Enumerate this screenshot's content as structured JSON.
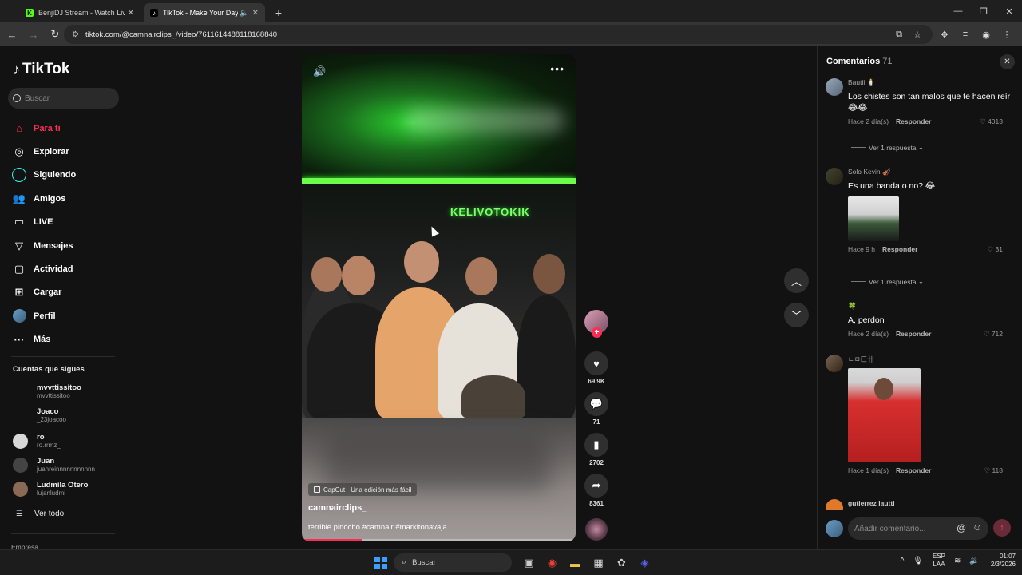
{
  "browser": {
    "tabs": [
      {
        "label": "BenjiDJ Stream - Watch Live o",
        "favicon": "kick-icon",
        "accent": "#53fc18"
      },
      {
        "label": "TikTok - Make Your Day",
        "favicon": "tiktok-icon",
        "accent": "#ffffff"
      }
    ],
    "new_tab": "+",
    "url": "tiktok.com/@camnairclips_/video/7611614488118168840"
  },
  "sidebar": {
    "logo": "TikTok",
    "search_placeholder": "Buscar",
    "nav": [
      {
        "label": "Para ti",
        "icon": "home-icon",
        "active": true
      },
      {
        "label": "Explorar",
        "icon": "compass-icon"
      },
      {
        "label": "Siguiendo",
        "icon": "following-ring-icon"
      },
      {
        "label": "Amigos",
        "icon": "friends-icon"
      },
      {
        "label": "LIVE",
        "icon": "live-icon"
      },
      {
        "label": "Mensajes",
        "icon": "messages-icon"
      },
      {
        "label": "Actividad",
        "icon": "activity-icon"
      },
      {
        "label": "Cargar",
        "icon": "upload-icon"
      },
      {
        "label": "Perfil",
        "icon": "profile-avatar-icon"
      },
      {
        "label": "Más",
        "icon": "more-icon"
      }
    ],
    "following_title": "Cuentas que sigues",
    "following": [
      {
        "name": "mvvttissitoo",
        "user": "mvvttissitoo"
      },
      {
        "name": "Joaco",
        "user": "_23joacoo"
      },
      {
        "name": "ro",
        "user": "ro.rrmz_"
      },
      {
        "name": "Juan",
        "user": "juanreinnnnnnnnnnn"
      },
      {
        "name": "Ludmila Otero",
        "user": "lujanludmi"
      }
    ],
    "see_all": "Ver todo",
    "footer": "Empresa"
  },
  "video": {
    "sign": "KELIVOTOKIK",
    "capcut": "CapCut · Una edición más fácil",
    "author": "camnairclips_",
    "caption": "terrible pinocho #camnair #markitonavaja",
    "progress": 0.22
  },
  "actions": {
    "likes": "69.9K",
    "comments": "71",
    "saves": "2702",
    "shares": "8361"
  },
  "comments": {
    "title": "Comentarios",
    "count": "71",
    "items": [
      {
        "user": "Bautii 🕯️",
        "text": "Los chistes son tan malos que te hacen reír 😂😂",
        "time": "Hace 2 día(s)",
        "reply": "Responder",
        "likes": "4013",
        "view_replies": "Ver 1 respuesta"
      },
      {
        "user": "Solo Kevin 🎻",
        "text": "Es una banda o no? 😂",
        "time": "Hace 9 h",
        "reply": "Responder",
        "likes": "31",
        "view_replies": "Ver 1 respuesta"
      },
      {
        "user": "🍀",
        "text": "A, perdon",
        "time": "Hace 2 día(s)",
        "reply": "Responder",
        "likes": "712"
      },
      {
        "user": "ㄴㅁ匚卄ㅣ",
        "text": "",
        "time": "Hace 1 día(s)",
        "reply": "Responder",
        "likes": "118"
      },
      {
        "user": "gutierrez lautti"
      }
    ],
    "input_placeholder": "Añadir comentario..."
  },
  "taskbar": {
    "search": "Buscar",
    "lang": "ESP",
    "lang2": "LAA",
    "time": "01:07",
    "date": "2/3/2026"
  }
}
